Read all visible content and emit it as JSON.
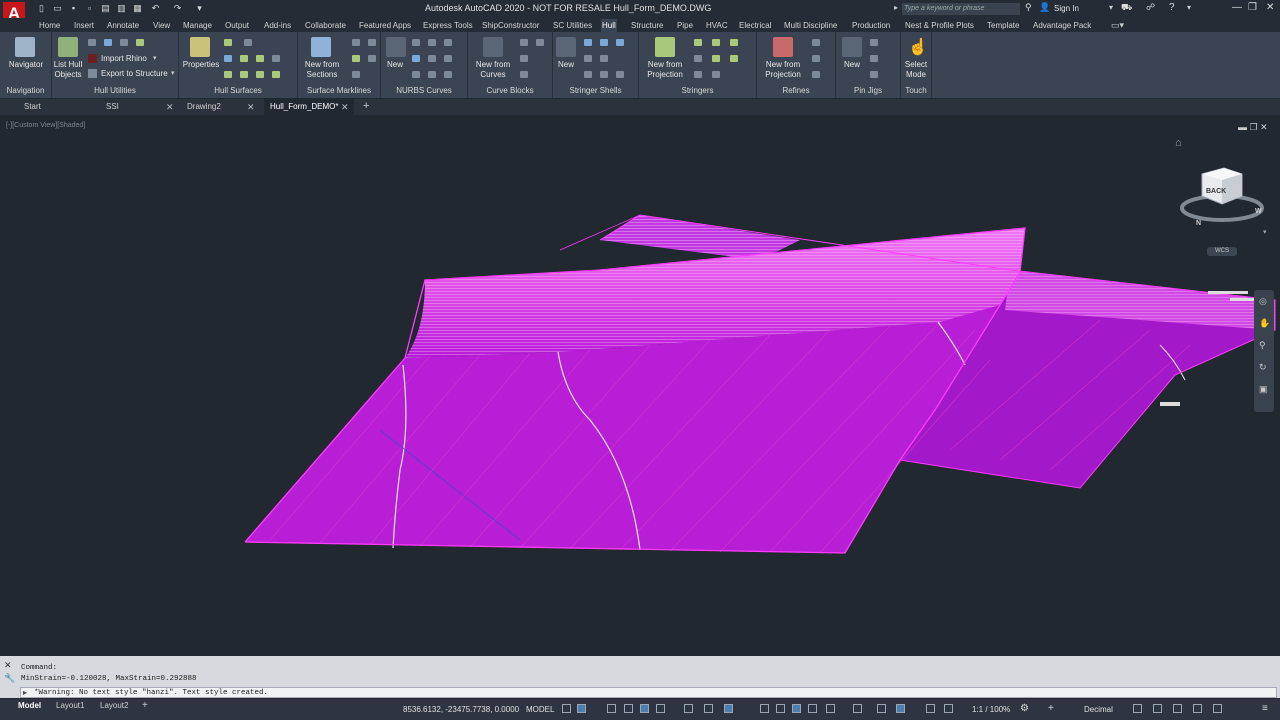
{
  "app": {
    "logo": "A",
    "title": "Autodesk AutoCAD 2020 - NOT FOR RESALE   Hull_Form_DEMO.DWG",
    "search_placeholder": "Type a keyword or phrase",
    "sign_in": "Sign In"
  },
  "menu_tabs": [
    "Home",
    "Insert",
    "Annotate",
    "View",
    "Manage",
    "Output",
    "Add-ins",
    "Collaborate",
    "Featured Apps",
    "Express Tools",
    "ShipConstructor",
    "SC Utilities",
    "Hull",
    "Structure",
    "Pipe",
    "HVAC",
    "Electrical",
    "Multi Discipline",
    "Production",
    "Nest & Profile Plots",
    "Template",
    "Advantage Pack"
  ],
  "active_menu_tab": "Hull",
  "ribbon": {
    "panels": [
      {
        "title": "Navigation",
        "buttons": [
          "Navigator"
        ]
      },
      {
        "title": "Hull Utilities",
        "buttons": [
          "List Hull\nObjects",
          "Import Rhino",
          "Export to Structure"
        ]
      },
      {
        "title": "Hull Surfaces",
        "buttons": [
          "Properties"
        ]
      },
      {
        "title": "Surface Marklines",
        "buttons": [
          "New from\nSections"
        ]
      },
      {
        "title": "NURBS Curves",
        "buttons": [
          "New"
        ]
      },
      {
        "title": "Curve Blocks",
        "buttons": [
          "New from\nCurves"
        ]
      },
      {
        "title": "Stringer Shells",
        "buttons": [
          "New"
        ]
      },
      {
        "title": "Stringers",
        "buttons": [
          "New from\nProjection"
        ]
      },
      {
        "title": "Refines",
        "buttons": [
          "New from\nProjection"
        ]
      },
      {
        "title": "Pin Jigs",
        "buttons": [
          "New"
        ]
      },
      {
        "title": "Touch",
        "buttons": [
          "Select\nMode"
        ]
      }
    ]
  },
  "doc_tabs": [
    "Start",
    "SSI",
    "Drawing2",
    "Hull_Form_DEMO*"
  ],
  "viewport": {
    "label": "[-][Custom View][Shaded]",
    "viewcube_face": "BACK",
    "wcs": "WCS",
    "compass": [
      "N",
      "W"
    ],
    "surface_color": "#c020e0"
  },
  "command": {
    "lines": [
      "Command:",
      "MinStrain=-0.120028, MaxStrain=0.292888"
    ],
    "input": "*Warning: No text style \"hanzi\". Text style created."
  },
  "status": {
    "layout_tabs": [
      "Model",
      "Layout1",
      "Layout2"
    ],
    "coords": "8536.6132, -23475.7738, 0.0000",
    "mode": "MODEL",
    "scale": "1:1 / 100%",
    "units": "Decimal"
  }
}
